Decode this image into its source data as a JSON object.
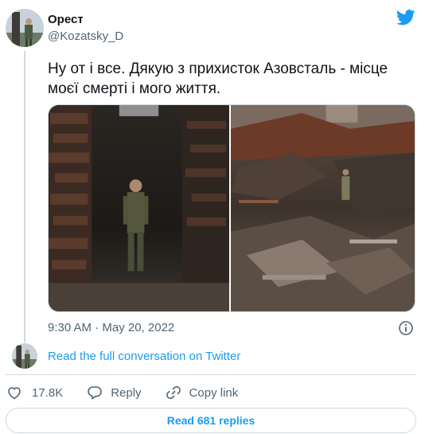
{
  "author": {
    "display_name": "Орест",
    "handle": "@Kozatsky_D"
  },
  "tweet": {
    "text": "Ну от і все. Дякую з прихисток Азовсталь - місце моєї смерті і мого життя.",
    "timestamp": "9:30 AM · May 20, 2022"
  },
  "links": {
    "read_conversation": "Read the full conversation on Twitter"
  },
  "actions": {
    "likes_count": "17.8K",
    "reply_label": "Reply",
    "copy_link_label": "Copy link"
  },
  "replies_button": "Read 681 replies",
  "icons": {
    "brand": "twitter-bird-icon",
    "info": "info-icon",
    "like": "heart-icon",
    "reply": "reply-icon",
    "copy": "link-icon"
  },
  "colors": {
    "accent": "#1d9bf0",
    "text": "#0f1419",
    "muted": "#536471",
    "border": "#cfd9de"
  }
}
